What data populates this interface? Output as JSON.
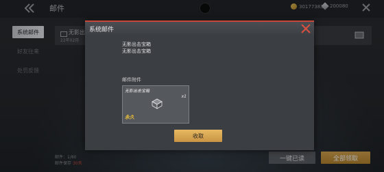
{
  "header": {
    "title": "邮件",
    "back_icon": "chevron-double-left-icon",
    "currency_coins": "30177383",
    "currency_gems": "200080",
    "close_icon": "close-icon"
  },
  "sidebar": {
    "items": [
      {
        "label": "系统邮件",
        "active": true
      },
      {
        "label": "好友往来",
        "active": false
      },
      {
        "label": "处罚反馈",
        "active": false
      }
    ]
  },
  "mail_list": {
    "items": [
      {
        "title": "无影出",
        "subtitle": "22年02月"
      }
    ]
  },
  "footer": {
    "mail_count": "邮件：1/80",
    "note_prefix": "邮件保存",
    "note_highlight": "30天"
  },
  "buttons": {
    "mark_all_read": "一键已读",
    "claim_all": "全部领取"
  },
  "modal": {
    "title": "系统邮件",
    "body_lines": [
      "无影出击宝箱",
      "无影出击宝箱"
    ],
    "attachments_label": "邮件附件",
    "attachment": {
      "name": "无影出击宝箱",
      "quantity": "x1",
      "icon": "treasure-chest-icon",
      "badge": "永久"
    },
    "claim_button": "收取"
  },
  "colors": {
    "accent_red": "#c74637",
    "gold_button": "#d7a54f"
  }
}
